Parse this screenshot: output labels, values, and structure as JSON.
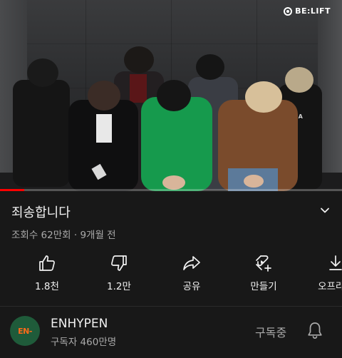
{
  "video": {
    "watermark": "BE:LIFT",
    "progress_fraction": 0.07,
    "progress_color": "#ff0000"
  },
  "title": "죄송합니다",
  "meta": "조회수 62만회 · 9개월 전",
  "actions": [
    {
      "icon": "thumbs-up-icon",
      "label": "1.8천"
    },
    {
      "icon": "thumbs-down-icon",
      "label": "1.2만"
    },
    {
      "icon": "share-icon",
      "label": "공유"
    },
    {
      "icon": "remix-icon",
      "label": "만들기"
    },
    {
      "icon": "download-icon",
      "label": "오프라인"
    }
  ],
  "channel": {
    "name": "ENHYPEN",
    "subscribers": "구독자 460만명",
    "avatar_text": "EN-",
    "subscribe_state": "구독중",
    "accent": "#ff6a1a",
    "avatar_bg": "#1f5b3a"
  }
}
